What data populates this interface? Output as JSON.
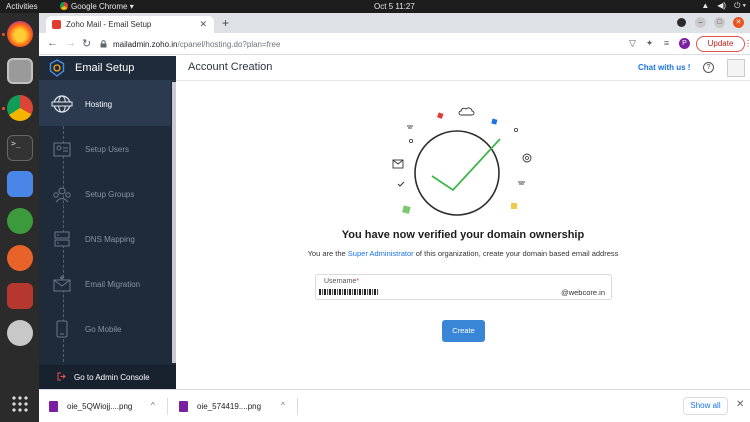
{
  "system_bar": {
    "activities": "Activities",
    "app_name": "Google Chrome",
    "clock": "Oct 5  11:27"
  },
  "browser": {
    "tab_title": "Zoho Mail - Email Setup",
    "url_host": "mailadmin.zoho.in",
    "url_path": "/cpanel/hosting.do?plan=free",
    "update_label": "Update",
    "profile_initial": "P"
  },
  "sidebar": {
    "title": "Email Setup",
    "items": [
      {
        "label": "Hosting",
        "active": true
      },
      {
        "label": "Setup Users",
        "active": false
      },
      {
        "label": "Setup Groups",
        "active": false
      },
      {
        "label": "DNS Mapping",
        "active": false
      },
      {
        "label": "Email Migration",
        "active": false
      },
      {
        "label": "Go Mobile",
        "active": false
      }
    ],
    "footer": "Go to Admin Console"
  },
  "header": {
    "title": "Account Creation",
    "chat": "Chat with us !",
    "help": "?"
  },
  "main": {
    "headline": "You have now verified your domain ownership",
    "sub_prefix": "You are the",
    "sub_role": "Super Administrator",
    "sub_suffix": "of this organization, create your domain based email address",
    "field_label": "Username",
    "field_required": "*",
    "domain_suffix": "@webcore.in",
    "create_button": "Create"
  },
  "downloads": {
    "items": [
      {
        "name": "oie_5QWiojj....png"
      },
      {
        "name": "oie_574419....png"
      }
    ],
    "show_all": "Show all",
    "close": "✕"
  },
  "colors": {
    "sidebar_bg": "#1f2a3a",
    "accent_blue": "#3a86d6",
    "check_green": "#3fb54a"
  }
}
